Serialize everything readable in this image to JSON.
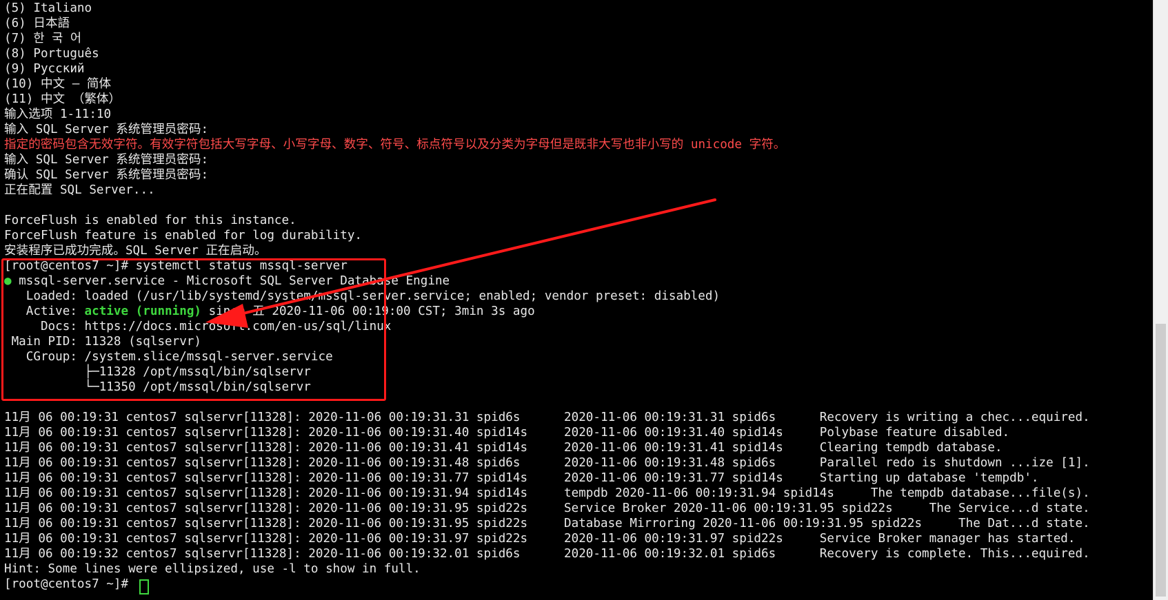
{
  "terminal": {
    "lines": [
      "(5) Italiano",
      "(6) 日本語",
      "(7) 한 국 어",
      "(8) Português",
      "(9) Русский",
      "(10) 中文 – 简体",
      "(11) 中文 （繁体）",
      "输入选项 1-11:10",
      "输入 SQL Server 系统管理员密码:",
      "指定的密码包含无效字符。有效字符包括大写字母、小写字母、数字、符号、标点符号以及分类为字母但是既非大写也非小写的 unicode 字符。",
      "输入 SQL Server 系统管理员密码:",
      "确认 SQL Server 系统管理员密码:",
      "正在配置 SQL Server...",
      "",
      "ForceFlush is enabled for this instance.",
      "ForceFlush feature is enabled for log durability.",
      "安装程序已成功完成。SQL Server 正在启动。",
      "[root@centos7 ~]# systemctl status mssql-server",
      "mssql-server.service - Microsoft SQL Server Database Engine",
      "   Loaded: loaded (/usr/lib/systemd/system/mssql-server.service; enabled; vendor preset: disabled)",
      "   Active: ",
      "active (running)",
      " since 五 2020-11-06 00:19:00 CST; 3min 3s ago",
      "     Docs: https://docs.microsoft.com/en-us/sql/linux",
      " Main PID: 11328 (sqlservr)",
      "   CGroup: /system.slice/mssql-server.service",
      "           ├─11328 /opt/mssql/bin/sqlservr",
      "           └─11350 /opt/mssql/bin/sqlservr",
      "",
      "11月 06 00:19:31 centos7 sqlservr[11328]: 2020-11-06 00:19:31.31 spid6s      2020-11-06 00:19:31.31 spid6s      Recovery is writing a chec...equired.",
      "11月 06 00:19:31 centos7 sqlservr[11328]: 2020-11-06 00:19:31.40 spid14s     2020-11-06 00:19:31.40 spid14s     Polybase feature disabled.",
      "11月 06 00:19:31 centos7 sqlservr[11328]: 2020-11-06 00:19:31.41 spid14s     2020-11-06 00:19:31.41 spid14s     Clearing tempdb database.",
      "11月 06 00:19:31 centos7 sqlservr[11328]: 2020-11-06 00:19:31.48 spid6s      2020-11-06 00:19:31.48 spid6s      Parallel redo is shutdown ...ize [1].",
      "11月 06 00:19:31 centos7 sqlservr[11328]: 2020-11-06 00:19:31.77 spid14s     2020-11-06 00:19:31.77 spid14s     Starting up database 'tempdb'.",
      "11月 06 00:19:31 centos7 sqlservr[11328]: 2020-11-06 00:19:31.94 spid14s     tempdb 2020-11-06 00:19:31.94 spid14s     The tempdb database...file(s).",
      "11月 06 00:19:31 centos7 sqlservr[11328]: 2020-11-06 00:19:31.95 spid22s     Service Broker 2020-11-06 00:19:31.95 spid22s     The Service...d state.",
      "11月 06 00:19:31 centos7 sqlservr[11328]: 2020-11-06 00:19:31.95 spid22s     Database Mirroring 2020-11-06 00:19:31.95 spid22s     The Dat...d state.",
      "11月 06 00:19:31 centos7 sqlservr[11328]: 2020-11-06 00:19:31.97 spid22s     2020-11-06 00:19:31.97 spid22s     Service Broker manager has started.",
      "11月 06 00:19:32 centos7 sqlservr[11328]: 2020-11-06 00:19:32.01 spid6s      2020-11-06 00:19:32.01 spid6s      Recovery is complete. This...equired.",
      "Hint: Some lines were ellipsized, use -l to show in full.",
      "[root@centos7 ~]# "
    ],
    "status_dot": "●"
  },
  "icons": {
    "status": "green-dot-icon",
    "cursor": "block-cursor-icon"
  },
  "colors": {
    "background": "#000000",
    "text": "#e8e8e8",
    "error": "#ff4b4b",
    "active": "#3fd83f",
    "annotation": "#ff1a1a"
  }
}
